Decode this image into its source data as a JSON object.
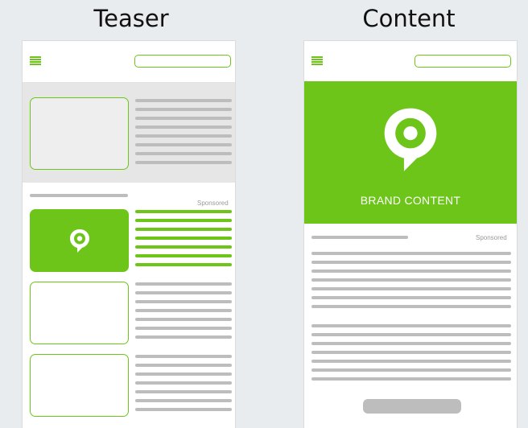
{
  "labels": {
    "teaser_title": "Teaser",
    "content_title": "Content"
  },
  "teaser": {
    "sponsored": "Sponsored"
  },
  "content": {
    "brand_label": "BRAND CONTENT",
    "sponsored": "Sponsored"
  },
  "colors": {
    "accent_green": "#6dc51a",
    "placeholder_grey": "#bdbdbd",
    "featured_bg": "#e6e6e6",
    "page_bg": "#e9ecee"
  },
  "icons": {
    "menu": "hamburger-menu-icon",
    "brand": "location-pin-icon"
  }
}
